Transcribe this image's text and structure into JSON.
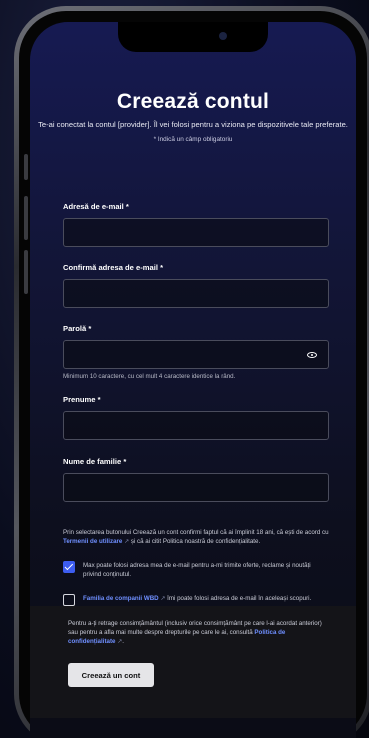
{
  "header": {
    "title": "Creează contul",
    "subtitle": "Te-ai conectat la contul [provider]. Îl vei folosi pentru a viziona pe dispozitivele tale preferate.",
    "required_note": "* Indică un câmp obligatoriu"
  },
  "form": {
    "email_label": "Adresă de e-mail *",
    "email_value": "",
    "confirm_email_label": "Confirmă adresa de e-mail *",
    "confirm_email_value": "",
    "password_label": "Parolă *",
    "password_value": "",
    "password_hint": "Minimum 10 caractere, cu cel mult 4 caractere identice la rând.",
    "first_name_label": "Prenume *",
    "first_name_value": "",
    "last_name_label": "Nume de familie *",
    "last_name_value": ""
  },
  "consent": {
    "terms_pre": "Prin selectarea butonului Creează un cont confirmi faptul că ai împlinit 18 ani, că ești de acord cu ",
    "terms_link": "Termenii de utilizare",
    "terms_post": " și că ai citit Politica noastră de confidențialitate.",
    "offers_text": "Max poate folosi adresa mea de e-mail pentru a-mi trimite oferte, reclame și noutăți privind conținutul.",
    "offers_checked": true,
    "wbd_link": "Familia de companii WBD",
    "wbd_text": " îmi poate folosi adresa de e-mail în aceleași scopuri.",
    "wbd_checked": false
  },
  "footer": {
    "withdraw_pre": "Pentru a-ți retrage consimțământul (inclusiv orice consimțământ pe care l-ai acordat anterior) sau pentru a afla mai multe despre drepturile pe care le ai, consultă ",
    "privacy_link": "Politica de confidențialitate",
    "withdraw_post": ".",
    "create_button": "Creează un cont"
  },
  "icons": {
    "external_link": "↗",
    "password_toggle": "eye-icon"
  },
  "colors": {
    "accent": "#3d5df0",
    "link": "#6f8fff",
    "background_top": "#161a52"
  }
}
